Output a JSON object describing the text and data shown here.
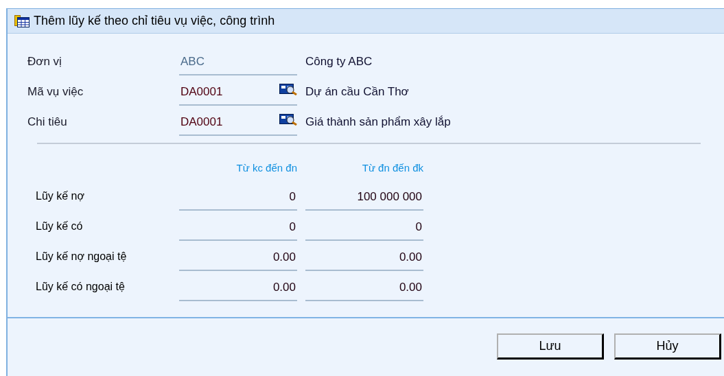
{
  "window": {
    "title": "Thêm lũy kế theo chỉ tiêu vụ việc, công trình"
  },
  "fields": [
    {
      "label": "Đơn vị",
      "value": "ABC",
      "disabled": true,
      "lookup": false,
      "description": "Công ty ABC"
    },
    {
      "label": "Mã vụ việc",
      "value": "DA0001",
      "disabled": false,
      "lookup": true,
      "description": "Dự án cầu Cần Thơ"
    },
    {
      "label": "Chi tiêu",
      "value": "DA0001",
      "disabled": false,
      "lookup": true,
      "description": "Giá thành sản phẩm xây lắp"
    }
  ],
  "table": {
    "columns": [
      "Từ kc đến đn",
      "Từ đn đến đk"
    ],
    "rows": [
      {
        "label": "Lũy kế nợ",
        "values": [
          "0",
          "100 000 000"
        ]
      },
      {
        "label": "Lũy kế có",
        "values": [
          "0",
          "0"
        ]
      },
      {
        "label": "Lũy kế nợ ngoại tệ",
        "values": [
          "0.00",
          "0.00"
        ]
      },
      {
        "label": "Lũy kế có ngoại tệ",
        "values": [
          "0.00",
          "0.00"
        ]
      }
    ]
  },
  "buttons": [
    "Lưu",
    "Hủy"
  ]
}
